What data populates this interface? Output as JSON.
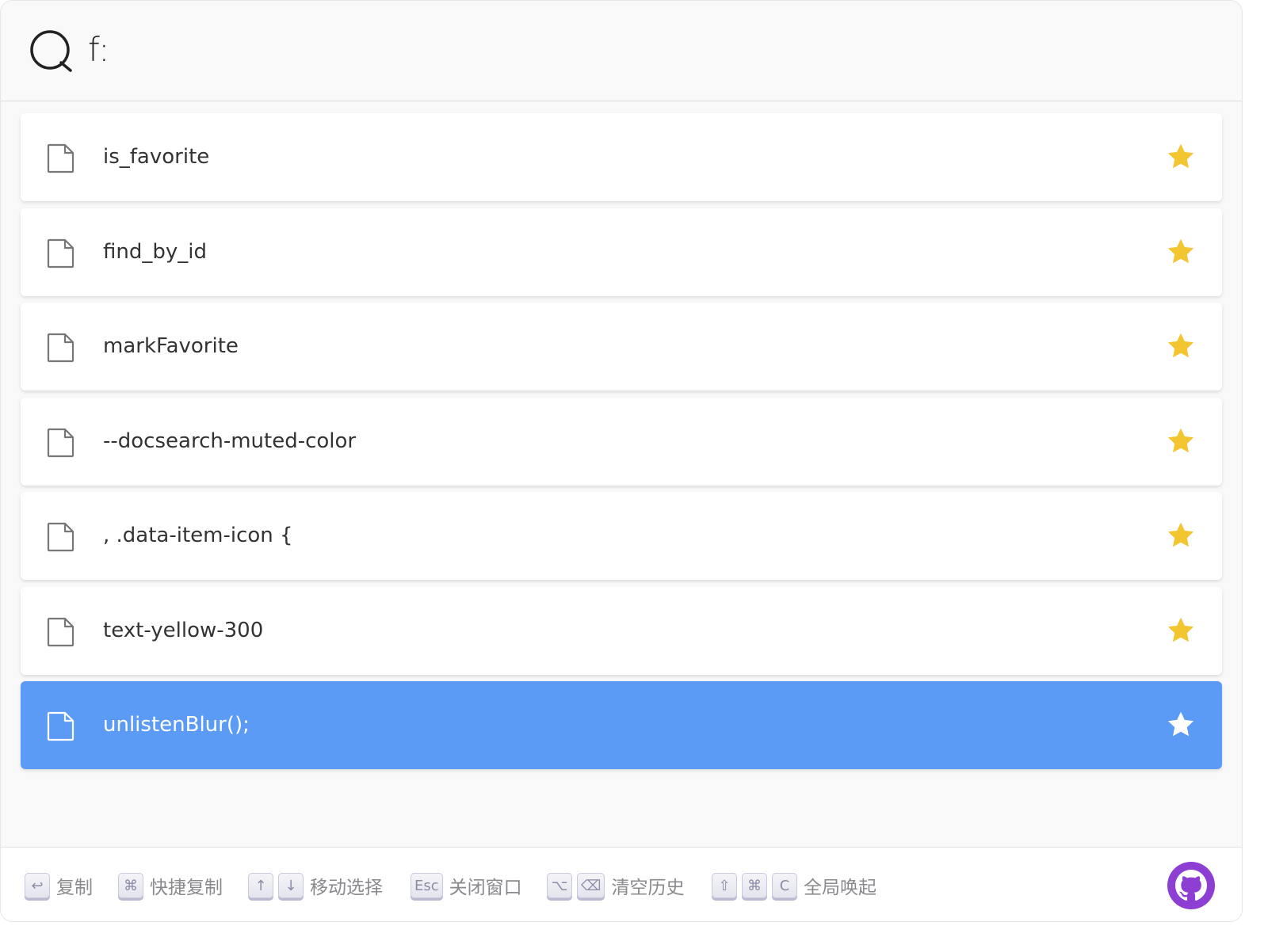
{
  "search": {
    "query": "f:"
  },
  "results": [
    {
      "label": "is_favorite",
      "starred": true,
      "selected": false
    },
    {
      "label": "find_by_id",
      "starred": true,
      "selected": false
    },
    {
      "label": "markFavorite",
      "starred": true,
      "selected": false
    },
    {
      "label": "--docsearch-muted-color",
      "starred": true,
      "selected": false
    },
    {
      "label": ", .data-item-icon {",
      "starred": true,
      "selected": false
    },
    {
      "label": "text-yellow-300",
      "starred": true,
      "selected": false
    },
    {
      "label": "unlistenBlur();",
      "starred": true,
      "selected": true
    }
  ],
  "footer": {
    "shortcuts": [
      {
        "keys": [
          "↩"
        ],
        "label": "复制"
      },
      {
        "keys": [
          "⌘"
        ],
        "label": "快捷复制"
      },
      {
        "keys": [
          "↑",
          "↓"
        ],
        "label": "移动选择"
      },
      {
        "keys": [
          "Esc"
        ],
        "label": "关闭窗口"
      },
      {
        "keys": [
          "⌥",
          "⌫"
        ],
        "label": "清空历史"
      },
      {
        "keys": [
          "⇧",
          "⌘",
          "C"
        ],
        "label": "全局唤起"
      }
    ],
    "github_icon": "github-icon"
  },
  "colors": {
    "selected_bg": "#5b9bf6",
    "star": "#f3c631",
    "github": "#8d3fd3"
  }
}
